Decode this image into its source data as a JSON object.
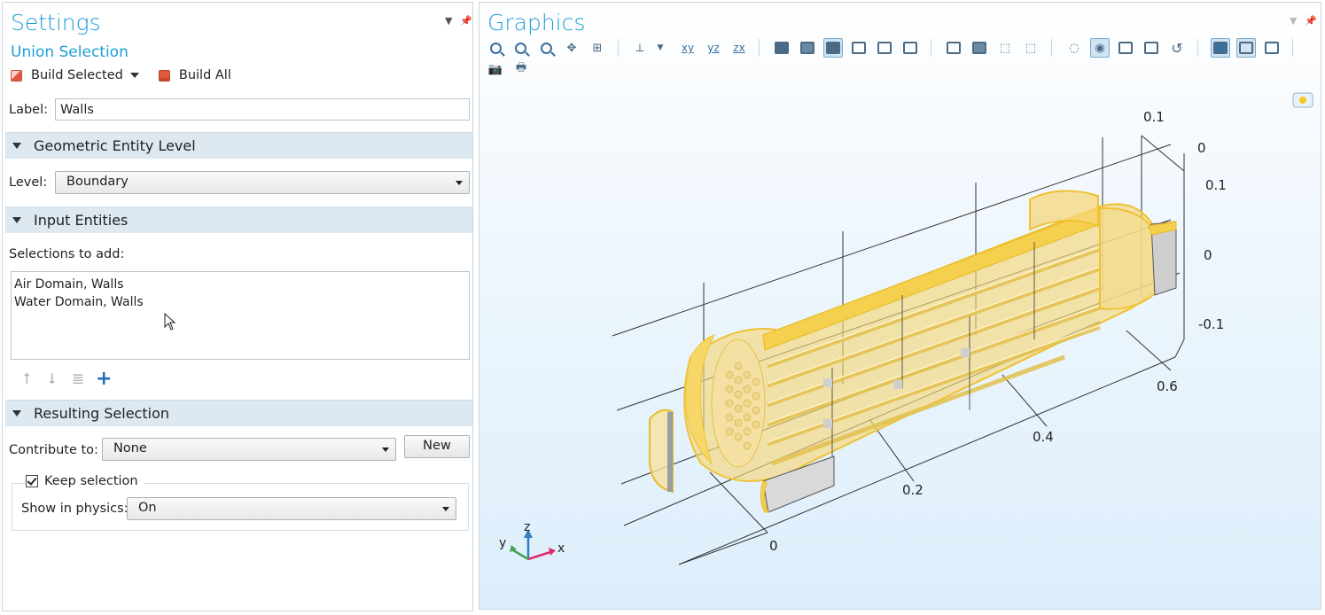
{
  "settings": {
    "title": "Settings",
    "subtitle": "Union Selection",
    "build_selected": "Build Selected",
    "build_all": "Build All",
    "label_caption": "Label:",
    "label_value": "Walls",
    "sections": {
      "geometric": "Geometric Entity Level",
      "input": "Input Entities",
      "resulting": "Resulting Selection"
    },
    "level_caption": "Level:",
    "level_value": "Boundary",
    "selections_caption": "Selections to add:",
    "selections": [
      "Air Domain, Walls",
      "Water Domain, Walls"
    ],
    "contribute_caption": "Contribute to:",
    "contribute_value": "None",
    "new_button": "New",
    "keep_selection": "Keep selection",
    "show_in_physics_caption": "Show in physics:",
    "show_in_physics_value": "On"
  },
  "graphics": {
    "title": "Graphics",
    "toolbar_axes": [
      "xy",
      "yz",
      "zx"
    ],
    "ticks": {
      "x": [
        "0",
        "0.2",
        "0.4",
        "0.6"
      ],
      "y": [
        "0.1",
        "0"
      ],
      "z": [
        "0.1",
        "0",
        "-0.1"
      ]
    },
    "triad": {
      "x": "x",
      "y": "y",
      "z": "z"
    }
  },
  "colors": {
    "accent": "#1e9fd6",
    "section_bg": "#dde8f1",
    "geometry_fill": "#f6dc88",
    "geometry_edge": "#f0c432",
    "triad_x": "#e02b6c",
    "triad_y": "#3fa34d",
    "triad_z": "#2f7fc1"
  }
}
